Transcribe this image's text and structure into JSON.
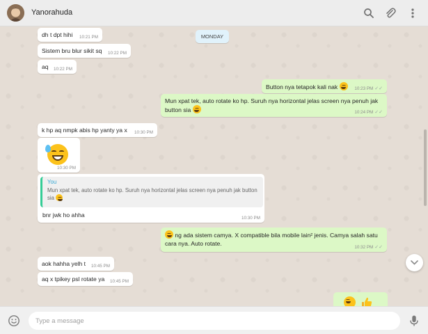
{
  "header": {
    "contact_name": "Yanorahuda"
  },
  "date_chip": "MONDAY",
  "messages": [
    {
      "text": "dh t dpt hihi",
      "time": "10:21 PM"
    },
    {
      "text": "Sistem bru blur sikit sq",
      "time": "10:22 PM"
    },
    {
      "text": "aq",
      "time": "10:22 PM"
    },
    {
      "text": "Button nya tetapok kali nak",
      "time": "10:23 PM"
    },
    {
      "text": "Mun xpat tek, auto rotate ko hp. Suruh nya horizontal jelas screen nya penuh jak button sia",
      "time": "10:24 PM"
    },
    {
      "text": "k hp aq nmpk abis hp yanty ya x",
      "time": "10:30 PM"
    },
    {
      "time": "10:30 PM"
    },
    {
      "quote_author": "You",
      "quote_text": "Mun xpat tek, auto rotate ko hp. Suruh nya horizontal jelas screen nya penuh jak button sia",
      "text": "bnr jwk ho ahha",
      "time": "10:30 PM"
    },
    {
      "text": "ng ada sistem camya. X compatible bila mobile lain² jenis. Camya salah satu cara nya. Auto rotate.",
      "time": "10:32 PM"
    },
    {
      "text": "aok hahha yelh t",
      "time": "10:45 PM"
    },
    {
      "text": "aq x tpikey psl rotate ya",
      "time": "10:45 PM"
    }
  ],
  "composer": {
    "placeholder": "Type a message"
  },
  "colors": {
    "incoming": "#ffffff",
    "outgoing": "#dcf8c6",
    "chat_bg": "#e5ddd5",
    "date_chip": "#e1f2fb",
    "quote_bar": "#35cd96"
  },
  "icons": [
    "search-icon",
    "attach-icon",
    "menu-icon",
    "emoji-icon",
    "mic-icon",
    "chevron-down-icon"
  ]
}
